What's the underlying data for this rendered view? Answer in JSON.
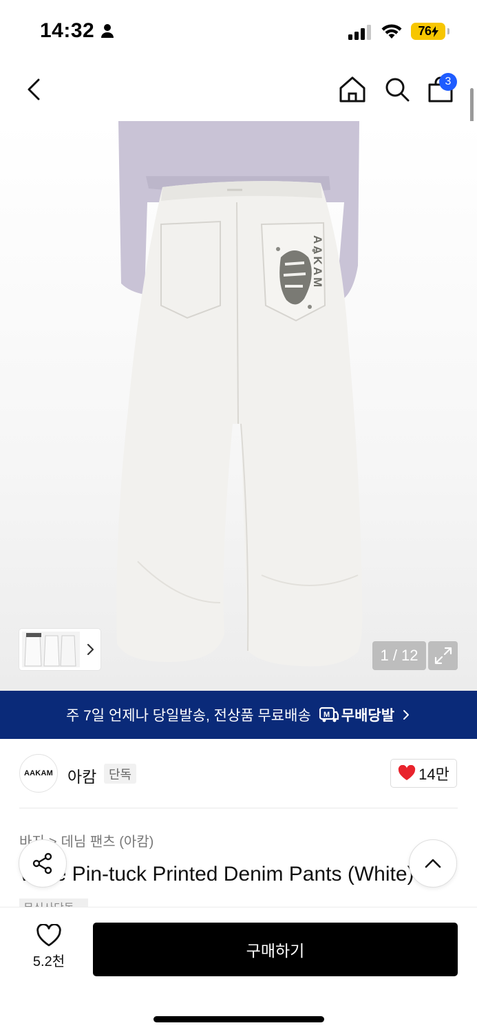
{
  "status_bar": {
    "time": "14:32",
    "battery": "76"
  },
  "nav": {
    "cart_count": "3"
  },
  "gallery": {
    "counter": "1 / 12",
    "print_text": "AAKAM"
  },
  "promo": {
    "text": "주 7일 언제나 당일발송, 전상품 무료배송",
    "logo_text": "무배당발"
  },
  "brand": {
    "logo_text": "AAKAM",
    "name": "아캄",
    "tag": "단독",
    "likes": "14만"
  },
  "product": {
    "breadcrumb": [
      "바지",
      "데님 팬츠 (아캄)"
    ],
    "title": "Wide Pin-tuck Printed Denim Pants (White)",
    "chip": "무신사단독"
  },
  "bottom_bar": {
    "wish_count": "5.2천",
    "buy_label": "구매하기"
  },
  "colors": {
    "banner_bg": "#0a2a79",
    "badge": "#1f5cff",
    "battery": "#f7c600",
    "heart": "#e8232c"
  }
}
